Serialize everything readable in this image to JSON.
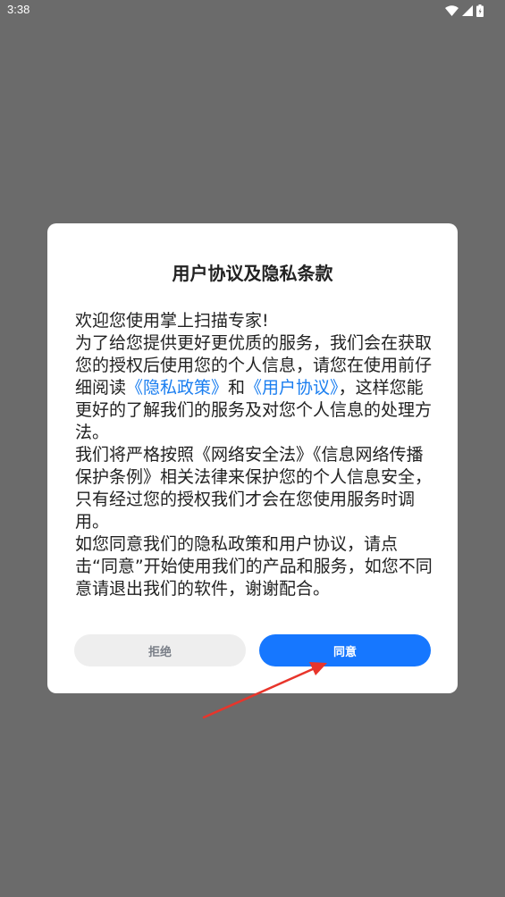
{
  "status_bar": {
    "time": "3:38",
    "icons": [
      "wifi-icon",
      "signal-icon",
      "battery-icon"
    ]
  },
  "dialog": {
    "title": "用户协议及隐私条款",
    "greeting": "欢迎您使用掌上扫描专家!",
    "p1_a": "为了给您提供更好更优质的服务，我们会在获取您的授权后使用您的个人信息，请您在使用前仔细阅读",
    "privacy_link": "《隐私政策》",
    "p1_b": "和",
    "user_agreement_link": "《用户协议》",
    "p1_c": "，这样您能更好的了解我们的服务及对您个人信息的处理方法。",
    "p2": "我们将严格按照《网络安全法》《信息网络传播保护条例》相关法律来保护您的个人信息安全，只有经过您的授权我们才会在您使用服务时调用。",
    "p3": "如您同意我们的隐私政策和用户协议，请点击“同意”开始使用我们的产品和服务，如您不同意请退出我们的软件，谢谢配合。",
    "reject_label": "拒绝",
    "agree_label": "同意"
  },
  "colors": {
    "link": "#1a7ef0",
    "agree_button": "#1677ff",
    "reject_button": "#eeeeee",
    "overlay": "#6b6b6b",
    "annotation_arrow": "#e8352b"
  }
}
